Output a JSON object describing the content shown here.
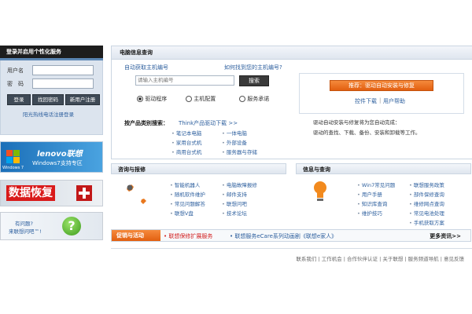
{
  "sidebar": {
    "login_title": "登录并启用个性化服务",
    "username_label": "用户名",
    "password_label": "密　码",
    "login_button": "登录",
    "forgot_button": "找回密码",
    "register_button": "新用户注册",
    "hotline_text": "阳光热线电话注册登录",
    "promo_lenovo_brand": "lenovo联想",
    "promo_lenovo_text": "Windows7支持专区",
    "promo_windows_logo": "Windows 7",
    "promo_recovery_text": "数据恢复",
    "promo_question_line1": "有问题?",
    "promo_question_line2": "来联想问吧™!"
  },
  "computer_info": {
    "title": "电脑信息查询",
    "get_host_no": "自动获取主机编号",
    "find_host_no": "如何找到您的主机编号?",
    "input_placeholder": "请输入主机编号",
    "search_button": "搜索",
    "radio_options": [
      "驱动程序",
      "主机配置",
      "服务承诺"
    ],
    "radio_selected": 0,
    "recommend_button": "推荐：驱动自动安装与修复",
    "control_download": "控件下载",
    "user_help": "用户帮助",
    "desc_line1": "驱动自动安装与修复将为您自动完成：",
    "desc_line2": "驱动的查找、下载、备份、安装和卸载等工作。",
    "category_label": "按产品类别搜索：",
    "think_link": "Think产品驱动下载 >>",
    "category_col1": [
      "笔记本电脑",
      "家用台式机",
      "商用台式机"
    ],
    "category_col2": [
      "一体电脑",
      "外部设备",
      "服务器与存储"
    ]
  },
  "consult": {
    "title": "咨询与报修",
    "col1": [
      "智能机器人",
      "随机软件维护",
      "常见问题解答",
      "联想V盘"
    ],
    "col2": [
      "电脑故障报修",
      "邮件支持",
      "联想问吧",
      "技术论坛"
    ]
  },
  "info": {
    "title": "信息与查询",
    "col1": [
      "Win7常见问题",
      "用户手册",
      "知识库查询",
      "维护技巧"
    ],
    "col2": [
      "联想服务政策",
      "部件保修查询",
      "维修网点查询",
      "常见电池处理",
      "手机获取方案"
    ]
  },
  "promo_bar": {
    "label": "促销与活动",
    "item1": "联想保修扩展服务",
    "item2": "联想服务eCare系列动画剧《联想e家人》",
    "more": "更多资讯>>"
  },
  "footer": {
    "links": [
      "联系我们",
      "工作机会",
      "合作伙伴认证",
      "关于联想",
      "服务频道导航",
      "意见反馈"
    ]
  },
  "colors": {
    "accent_orange": "#ee6b1a",
    "link_blue": "#2d5f9e",
    "panel_border": "#cbd6e2"
  }
}
